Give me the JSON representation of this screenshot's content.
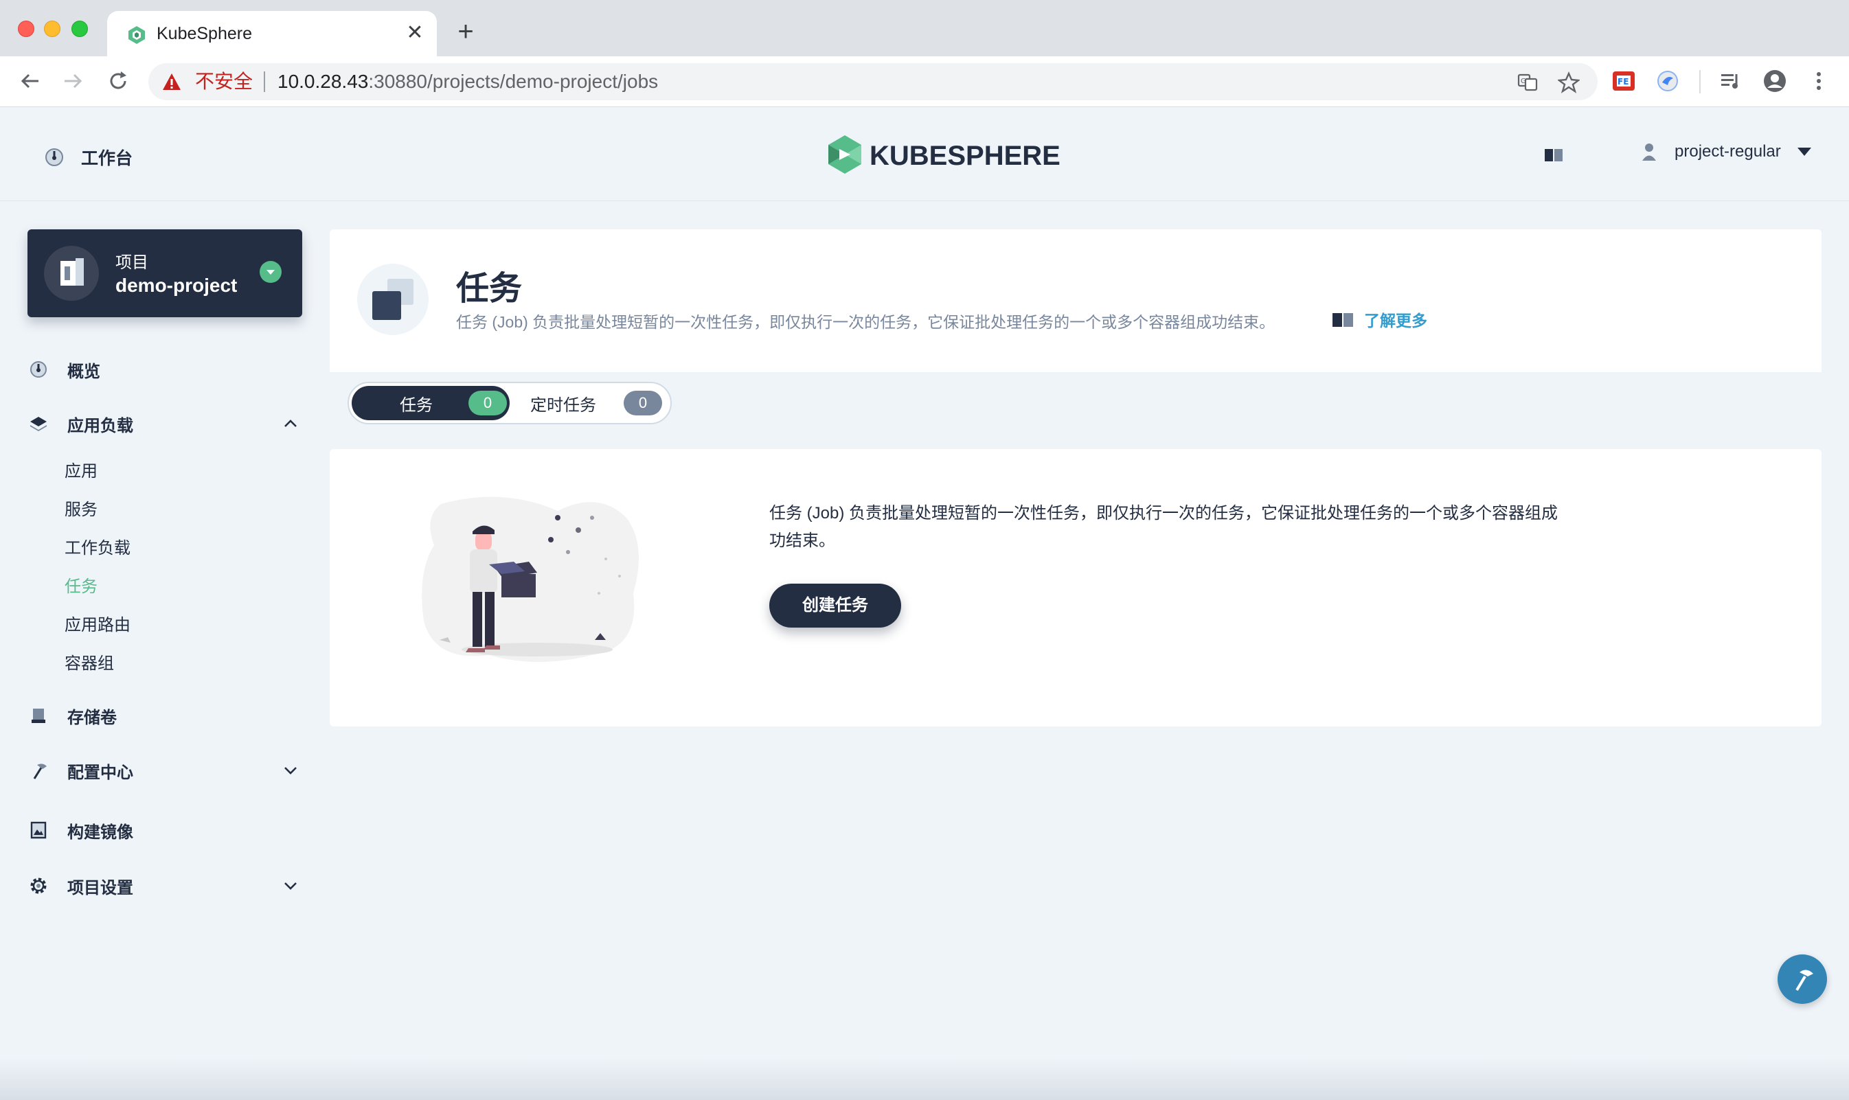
{
  "browser": {
    "tab_title": "KubeSphere",
    "tab_close": "✕",
    "new_tab": "+",
    "insecure_label": "不安全",
    "url_host": "10.0.28.43",
    "url_rest": ":30880/projects/demo-project/jobs"
  },
  "header": {
    "workbench_label": "工作台",
    "logo_text": "KUBESPHERE",
    "user_name": "project-regular"
  },
  "sidebar": {
    "project_type": "项目",
    "project_name": "demo-project",
    "nav": {
      "overview": "概览",
      "workloads_group": "应用负载",
      "apps": "应用",
      "services": "服务",
      "workloads": "工作负载",
      "jobs": "任务",
      "ingress": "应用路由",
      "pods": "容器组",
      "volumes": "存储卷",
      "config_center": "配置中心",
      "image_builder": "构建镜像",
      "project_settings": "项目设置"
    }
  },
  "banner": {
    "title": "任务",
    "description": "任务 (Job) 负责批量处理短暂的一次性任务，即仅执行一次的任务，它保证批处理任务的一个或多个容器组成功结束。",
    "learn_more": "了解更多",
    "tabs": [
      {
        "label": "任务",
        "count": "0",
        "active": true
      },
      {
        "label": "定时任务",
        "count": "0",
        "active": false
      }
    ]
  },
  "empty": {
    "description": "任务 (Job) 负责批量处理短暂的一次性任务，即仅执行一次的任务，它保证批处理任务的一个或多个容器组成功结束。",
    "create_label": "创建任务"
  },
  "colors": {
    "brand_dark": "#242e42",
    "accent_green": "#55bc8a",
    "link_blue": "#329dce",
    "muted": "#79879c",
    "page_bg": "#eff4f9"
  }
}
